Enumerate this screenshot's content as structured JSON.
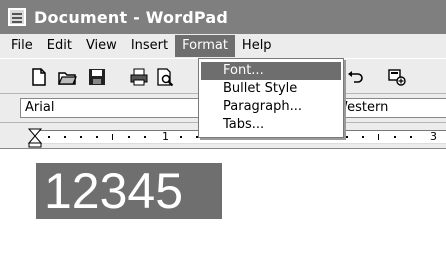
{
  "window": {
    "title": "Document - WordPad",
    "icon": "document-icon"
  },
  "menubar": {
    "items": [
      "File",
      "Edit",
      "View",
      "Insert",
      "Format",
      "Help"
    ],
    "open": "Format"
  },
  "format_menu": {
    "items": [
      "Font...",
      "Bullet Style",
      "Paragraph...",
      "Tabs..."
    ],
    "highlighted": "Font..."
  },
  "toolbar": {
    "icons": [
      "new-icon",
      "open-icon",
      "save-icon",
      "print-icon",
      "print-preview-icon",
      "undo-icon",
      "insert-object-icon"
    ]
  },
  "formatbar": {
    "font": "Arial",
    "script": "Western"
  },
  "ruler": {
    "numbers": [
      "1",
      "2",
      "3"
    ]
  },
  "document": {
    "selected_text": "12345"
  },
  "colors": {
    "highlight": "#6e6e6e",
    "title_bar": "#7f7f7f",
    "selection": "#6f6f6f"
  }
}
